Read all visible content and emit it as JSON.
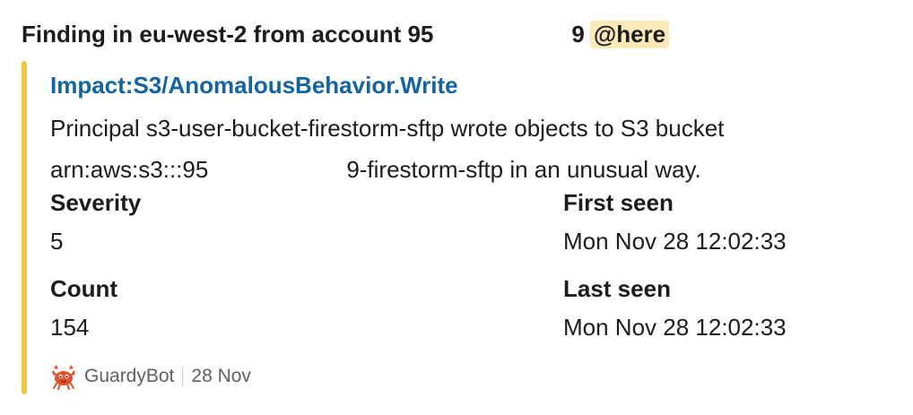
{
  "message": {
    "header_prefix": "Finding in eu-west-2 from account 95",
    "header_suffix": "9",
    "mention": "@here"
  },
  "attachment": {
    "bar_color": "#f2c744",
    "title": "Impact:S3/AnomalousBehavior.Write",
    "text_line1": "Principal s3-user-bucket-firestorm-sftp wrote objects to S3 bucket",
    "text_line2_part1": "arn:aws:s3:::95",
    "text_line2_part2": "9-firestorm-sftp in an unusual way.",
    "fields": [
      {
        "label": "Severity",
        "value": "5"
      },
      {
        "label": "First seen",
        "value": "Mon Nov 28 12:02:33"
      },
      {
        "label": "Count",
        "value": "154"
      },
      {
        "label": "Last seen",
        "value": "Mon Nov 28 12:02:33"
      }
    ],
    "footer": {
      "icon": "crab-bot-icon",
      "bot_name": "GuardyBot",
      "date": "28 Nov"
    }
  }
}
